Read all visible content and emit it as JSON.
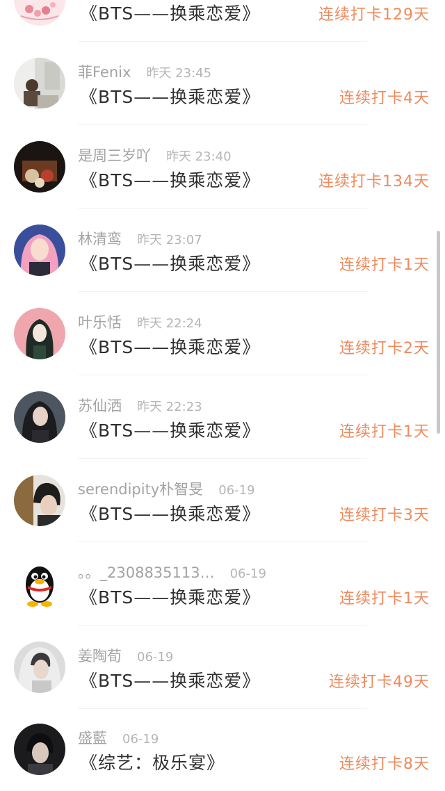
{
  "entries": [
    {
      "username": "",
      "time": "",
      "title": "《BTS——换乘恋爱》",
      "streak": "连续打卡129天",
      "avatar": "pink-flower-avatar"
    },
    {
      "username": "菲Fenix",
      "time": "昨天 23:45",
      "title": "《BTS——换乘恋爱》",
      "streak": "连续打卡4天",
      "avatar": "person-photo-avatar"
    },
    {
      "username": "是周三岁吖",
      "time": "昨天 23:40",
      "title": "《BTS——换乘恋爱》",
      "streak": "连续打卡134天",
      "avatar": "toy-bear-avatar"
    },
    {
      "username": "林清鸾",
      "time": "昨天 23:07",
      "title": "《BTS——换乘恋爱》",
      "streak": "连续打卡1天",
      "avatar": "pink-hair-girl-avatar"
    },
    {
      "username": "叶乐恬",
      "time": "昨天 22:24",
      "title": "《BTS——换乘恋爱》",
      "streak": "连续打卡2天",
      "avatar": "anime-girl-avatar"
    },
    {
      "username": "苏仙洒",
      "time": "昨天 22:23",
      "title": "《BTS——换乘恋爱》",
      "streak": "连续打卡1天",
      "avatar": "dark-hair-woman-avatar"
    },
    {
      "username": "serendipity朴智旻",
      "time": "06-19",
      "title": "《BTS——换乘恋爱》",
      "streak": "连续打卡3天",
      "avatar": "young-man-avatar"
    },
    {
      "username": "。。_2308835113…",
      "time": "06-19",
      "title": "《BTS——换乘恋爱》",
      "streak": "连续打卡1天",
      "avatar": "qq-penguin-avatar"
    },
    {
      "username": "姜陶荀",
      "time": "06-19",
      "title": "《BTS——换乘恋爱》",
      "streak": "连续打卡49天",
      "avatar": "veiled-man-avatar"
    },
    {
      "username": "盛藍",
      "time": "06-19",
      "title": "《综艺：极乐宴》",
      "streak": "连续打卡8天",
      "avatar": "dark-photo-avatar"
    }
  ],
  "colors": {
    "streak": "#ee8a5c",
    "title": "#2f2f2f",
    "meta": "#a6a6a6",
    "divider": "#f2f2f2"
  }
}
